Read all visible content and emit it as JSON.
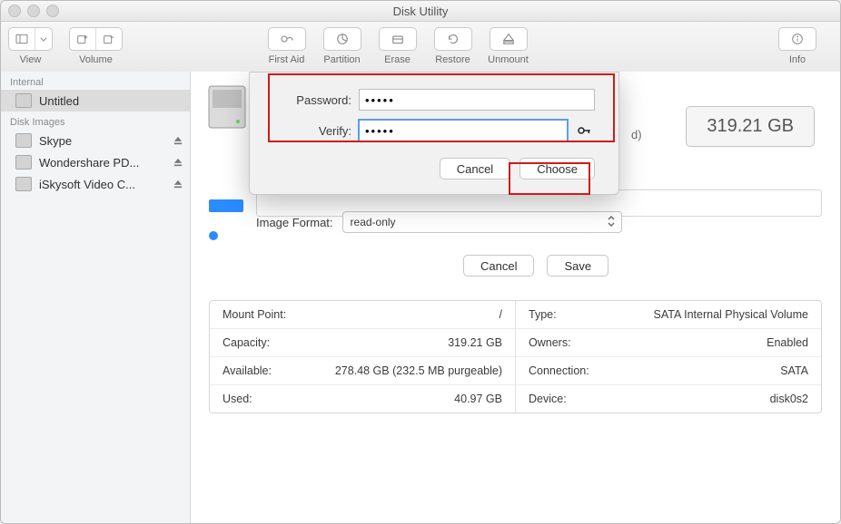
{
  "window": {
    "title": "Disk Utility"
  },
  "toolbar": {
    "view": "View",
    "volume": "Volume",
    "first_aid": "First Aid",
    "partition": "Partition",
    "erase": "Erase",
    "restore": "Restore",
    "unmount": "Unmount",
    "info": "Info"
  },
  "sidebar": {
    "headers": {
      "internal": "Internal",
      "disk_images": "Disk Images"
    },
    "internal": [
      {
        "label": "Untitled"
      }
    ],
    "images": [
      {
        "label": "Skype"
      },
      {
        "label": "Wondershare PD..."
      },
      {
        "label": "iSkysoft Video C..."
      }
    ]
  },
  "paren_d": "d)",
  "size_badge": "319.21 GB",
  "image_format": {
    "label": "Image Format:",
    "value": "read-only"
  },
  "sheet": {
    "cancel": "Cancel",
    "save": "Save"
  },
  "modal": {
    "password_label": "Password:",
    "verify_label": "Verify:",
    "password_value": "•••••",
    "verify_value": "•••••",
    "cancel": "Cancel",
    "choose": "Choose"
  },
  "info_left": [
    {
      "k": "Mount Point:",
      "v": "/"
    },
    {
      "k": "Capacity:",
      "v": "319.21 GB"
    },
    {
      "k": "Available:",
      "v": "278.48 GB (232.5 MB purgeable)"
    },
    {
      "k": "Used:",
      "v": "40.97 GB"
    }
  ],
  "info_right": [
    {
      "k": "Type:",
      "v": "SATA Internal Physical Volume"
    },
    {
      "k": "Owners:",
      "v": "Enabled"
    },
    {
      "k": "Connection:",
      "v": "SATA"
    },
    {
      "k": "Device:",
      "v": "disk0s2"
    }
  ]
}
